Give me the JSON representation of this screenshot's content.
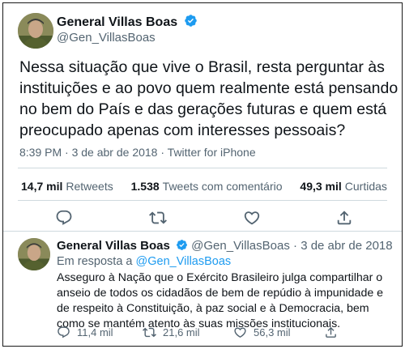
{
  "main_tweet": {
    "author_name": "General Villas Boas",
    "handle": "@Gen_VillasBoas",
    "text": "Nessa situação que vive o Brasil, resta perguntar às instituições e ao povo quem realmente está pensando no bem do País e das gerações futuras e quem está preocupado apenas com interesses pessoais?",
    "time": "8:39 PM",
    "date": "3 de abr de 2018",
    "separator": "·",
    "source": "Twitter for iPhone",
    "stats": {
      "retweets_count": "14,7 mil",
      "retweets_label": "Retweets",
      "quotes_count": "1.538",
      "quotes_label": "Tweets com comentário",
      "likes_count": "49,3 mil",
      "likes_label": "Curtidas"
    },
    "actions": [
      "reply-icon",
      "retweet-icon",
      "like-icon",
      "share-icon"
    ]
  },
  "reply_tweet": {
    "author_name": "General Villas Boas",
    "handle": "@Gen_VillasBoas",
    "separator": "·",
    "date": "3 de abr de 2018",
    "reply_prefix": "Em resposta a",
    "reply_handle": "@Gen_VillasBoas",
    "text": "Asseguro à Nação que o Exército Brasileiro julga compartilhar o anseio de todos os cidadãos de bem de repúdio à impunidade e de respeito à Constituição, à paz social e à Democracia, bem como se mantém atento às suas missões institucionais.",
    "replies": "11,4 mil",
    "retweets": "21,6 mil",
    "likes": "56,3 mil"
  },
  "colors": {
    "text": "#0f1419",
    "secondary": "#536471",
    "link": "#1d9bf0",
    "verified": "#1d9bf0",
    "divider": "#cfd9de"
  }
}
